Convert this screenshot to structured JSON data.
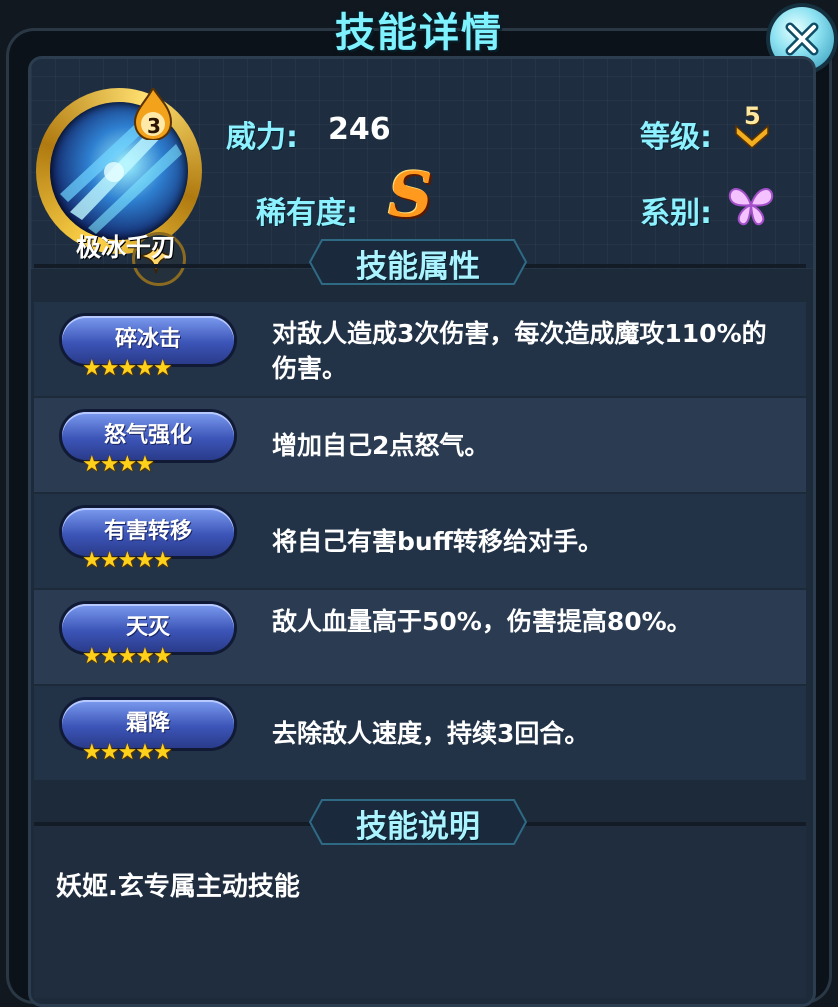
{
  "window": {
    "title": "技能详情"
  },
  "skill": {
    "name": "极冰千刃",
    "level_badge": "3",
    "power_label": "威力:",
    "power_value": "246",
    "grade_label": "等级:",
    "grade_value": "5",
    "rarity_label": "稀有度:",
    "rarity_value": "S",
    "series_label": "系别:",
    "series_icon": "butterfly-icon"
  },
  "attributes": {
    "title": "技能属性",
    "items": [
      {
        "label": "碎冰击",
        "stars": "★★★★★",
        "desc": "对敌人造成3次伤害，每次造成魔攻110%的伤害。"
      },
      {
        "label": "怒气强化",
        "stars": "★★★★",
        "desc": "增加自己2点怒气。"
      },
      {
        "label": "有害转移",
        "stars": "★★★★★",
        "desc": "将自己有害buff转移给对手。"
      },
      {
        "label": "天灭",
        "stars": "★★★★★",
        "desc": "敌人血量高于50%，伤害提高80%。"
      },
      {
        "label": "霜降",
        "stars": "★★★★★",
        "desc": "去除敌人速度，持续3回合。"
      }
    ]
  },
  "description": {
    "title": "技能说明",
    "text": "妖姬.玄专属主动技能"
  },
  "colors": {
    "title_cyan": "#7ff2ff",
    "pill_blue": "#3c55b8",
    "star_gold": "#ffd11a",
    "rarity_orange": "#ff9a1f"
  }
}
